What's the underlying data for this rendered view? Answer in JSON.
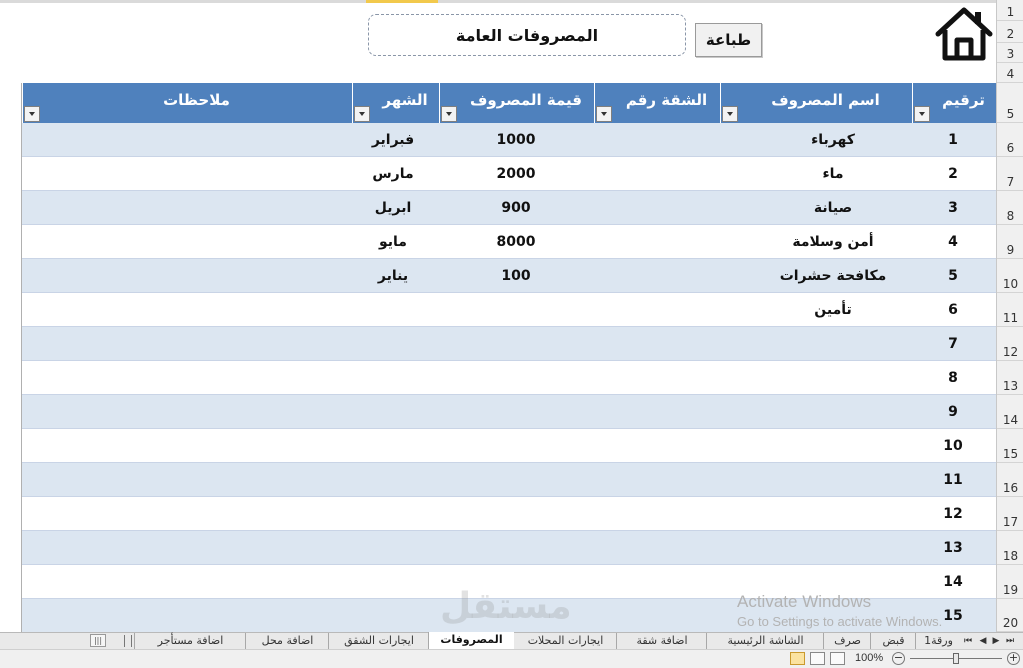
{
  "header": {
    "title": "المصروفات العامة",
    "print_label": "طباعة"
  },
  "table": {
    "columns": [
      "ترقيم",
      "اسم المصروف",
      "الشقة رقم",
      "قيمة المصروف",
      "الشهر",
      "ملاحظات"
    ],
    "rows": [
      {
        "num": "1",
        "name": "كهرباء",
        "apt": "",
        "amount": "1000",
        "month": "فبراير",
        "notes": ""
      },
      {
        "num": "2",
        "name": "ماء",
        "apt": "",
        "amount": "2000",
        "month": "مارس",
        "notes": ""
      },
      {
        "num": "3",
        "name": "صيانة",
        "apt": "",
        "amount": "900",
        "month": "ابريل",
        "notes": ""
      },
      {
        "num": "4",
        "name": "أمن وسلامة",
        "apt": "",
        "amount": "8000",
        "month": "مايو",
        "notes": ""
      },
      {
        "num": "5",
        "name": "مكافحة حشرات",
        "apt": "",
        "amount": "100",
        "month": "يناير",
        "notes": ""
      },
      {
        "num": "6",
        "name": "تأمين",
        "apt": "",
        "amount": "",
        "month": "",
        "notes": ""
      },
      {
        "num": "7",
        "name": "",
        "apt": "",
        "amount": "",
        "month": "",
        "notes": ""
      },
      {
        "num": "8",
        "name": "",
        "apt": "",
        "amount": "",
        "month": "",
        "notes": ""
      },
      {
        "num": "9",
        "name": "",
        "apt": "",
        "amount": "",
        "month": "",
        "notes": ""
      },
      {
        "num": "10",
        "name": "",
        "apt": "",
        "amount": "",
        "month": "",
        "notes": ""
      },
      {
        "num": "11",
        "name": "",
        "apt": "",
        "amount": "",
        "month": "",
        "notes": ""
      },
      {
        "num": "12",
        "name": "",
        "apt": "",
        "amount": "",
        "month": "",
        "notes": ""
      },
      {
        "num": "13",
        "name": "",
        "apt": "",
        "amount": "",
        "month": "",
        "notes": ""
      },
      {
        "num": "14",
        "name": "",
        "apt": "",
        "amount": "",
        "month": "",
        "notes": ""
      },
      {
        "num": "15",
        "name": "",
        "apt": "",
        "amount": "",
        "month": "",
        "notes": ""
      }
    ]
  },
  "row_numbers": [
    "1",
    "2",
    "3",
    "4",
    "5",
    "6",
    "7",
    "8",
    "9",
    "10",
    "11",
    "12",
    "13",
    "14",
    "15",
    "16",
    "17",
    "18",
    "19",
    "20"
  ],
  "sheet_tabs": {
    "tabs": [
      "ورقة1",
      "قبض",
      "صرف",
      "الشاشة الرئيسية",
      "اضافة شقة",
      "ايجارات المحلات",
      "المصروفات",
      "ايجارات الشقق",
      "اضافة محل",
      "اضافة مستأجر"
    ],
    "active": "المصروفات"
  },
  "status_bar": {
    "zoom": "100%"
  },
  "watermark": {
    "activate_line1": "Activate Windows",
    "activate_line2": "Go to Settings to activate Windows.",
    "site": "مستقل"
  },
  "colors": {
    "header_blue": "#4f81bd",
    "band_blue": "#dce6f1"
  },
  "icons": {
    "home": "home-icon",
    "dropdown": "filter-dropdown-icon"
  }
}
